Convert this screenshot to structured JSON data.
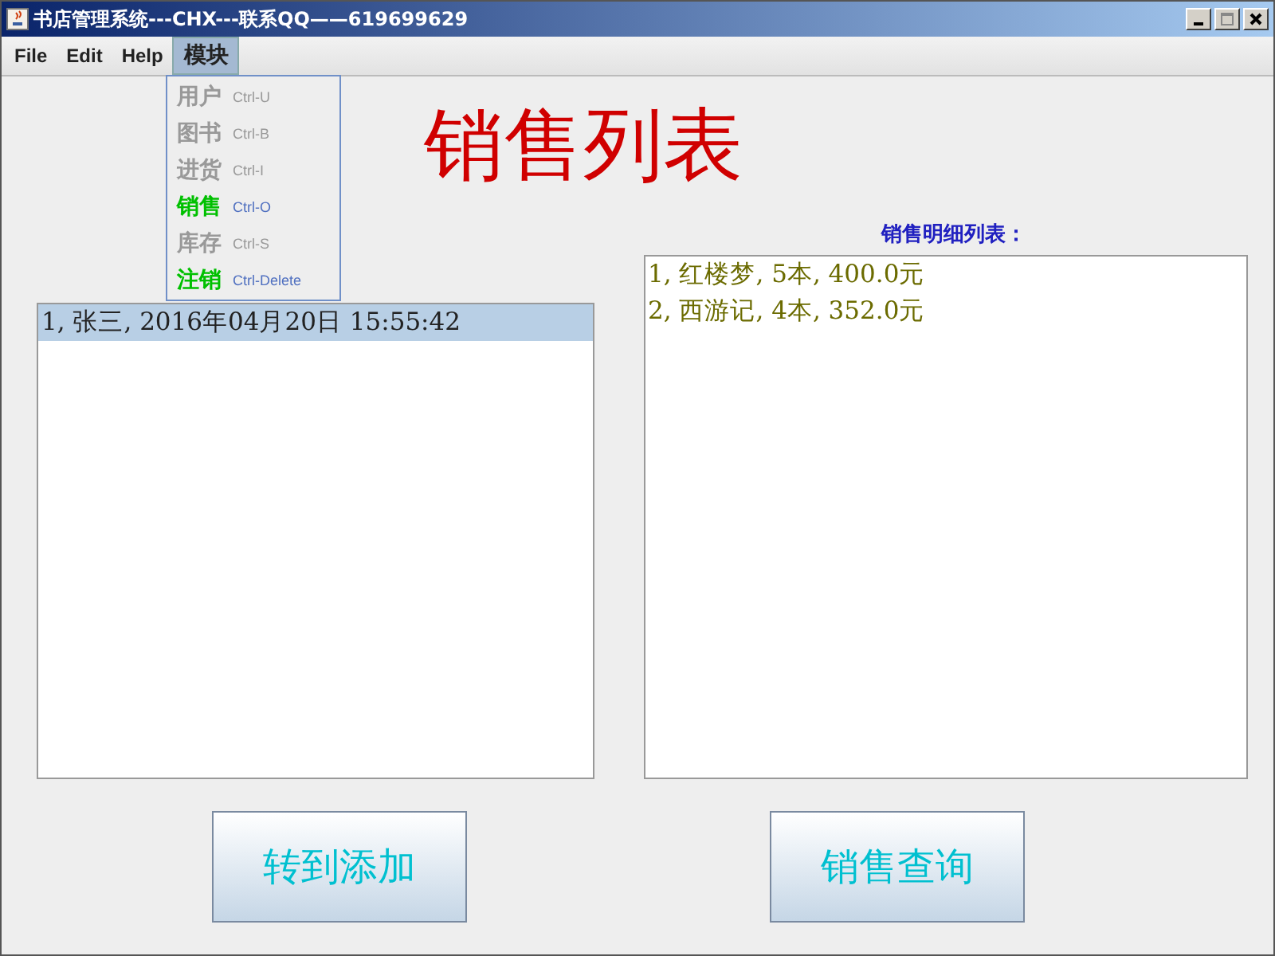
{
  "window": {
    "title": "书店管理系统---CHX---联系QQ——619699629"
  },
  "menu_bar": [
    {
      "label": "File",
      "selected": false
    },
    {
      "label": "Edit",
      "selected": false
    },
    {
      "label": "Help",
      "selected": false
    },
    {
      "label": "模块",
      "selected": true
    }
  ],
  "menu": [
    {
      "label": "用户",
      "shortcut": "Ctrl-U",
      "disabled": true
    },
    {
      "label": "图书",
      "shortcut": "Ctrl-B",
      "disabled": true
    },
    {
      "label": "进货",
      "shortcut": "Ctrl-I",
      "disabled": true
    },
    {
      "label": "销售",
      "shortcut": "Ctrl-O",
      "disabled": false
    },
    {
      "label": "库存",
      "shortcut": "Ctrl-S",
      "disabled": true
    },
    {
      "label": "注销",
      "shortcut": "Ctrl-Delete",
      "disabled": false
    }
  ],
  "heading": "销售列表",
  "sales_list": [
    {
      "text": "1, 张三, 2016年04月20日 15:55:42",
      "selected": true
    }
  ],
  "detail_label": "销售明细列表：",
  "detail_list": [
    {
      "text": "1, 红楼梦, 5本, 400.0元",
      "selected": false
    },
    {
      "text": "2, 西游记, 4本, 352.0元",
      "selected": false
    }
  ],
  "buttons": [
    "转到添加",
    "销售查询"
  ]
}
